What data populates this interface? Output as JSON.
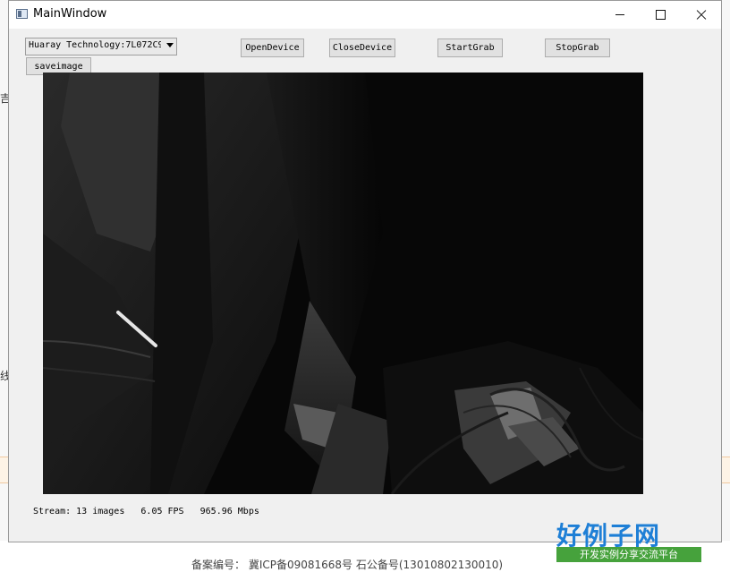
{
  "window": {
    "title": "MainWindow",
    "controls": {
      "minimize": "minimize-icon",
      "maximize": "maximize-icon",
      "close": "close-icon"
    }
  },
  "toolbar": {
    "device_select": {
      "selected": "Huaray Technology:7L072C9"
    },
    "open_label": "OpenDevice",
    "close_label": "CloseDevice",
    "start_label": "StartGrab",
    "stop_label": "StopGrab",
    "save_label": "saveimage"
  },
  "status": {
    "text": "Stream: 13 images   6.05 FPS   965.96 Mbps"
  },
  "watermark": {
    "logo": "好例子网",
    "slogan": "开发实例分享交流平台"
  },
  "background": {
    "left_chars": [
      "吉",
      "线"
    ],
    "footer_text": "备案编号：  冀ICP备09081668号  石公备号(13010802130010)"
  },
  "colors": {
    "window_bg": "#f0f0f0",
    "camera_bg": "#050505",
    "logo_blue": "#1e7fd6",
    "slogan_green": "#46a23c"
  }
}
